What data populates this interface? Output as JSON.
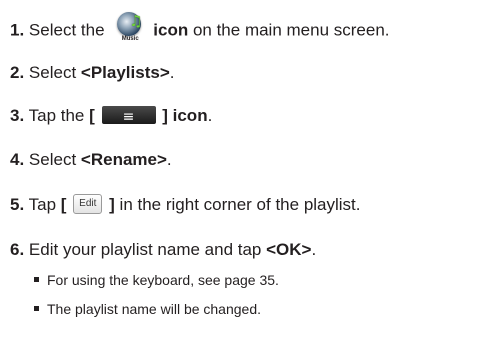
{
  "steps": [
    {
      "num": "1.",
      "pre": "Select the",
      "icon_caption": "Music",
      "icon_name": "music-app-icon",
      "bold": "icon",
      "post": "on the main menu screen."
    },
    {
      "num": "2.",
      "pre": "Select",
      "bold": "<Playlists>",
      "post": "."
    },
    {
      "num": "3.",
      "pre": "Tap the",
      "bracket_open": "[",
      "bold": "] icon",
      "post": ".",
      "key_glyph": "≡"
    },
    {
      "num": "4.",
      "pre": "Select",
      "bold": "<Rename>",
      "post": "."
    },
    {
      "num": "5.",
      "pre": "Tap",
      "bracket_open": "[",
      "button_label": "Edit",
      "bold": "]",
      "post": "in the right corner of the playlist."
    },
    {
      "num": "6.",
      "pre": "Edit your playlist name and tap",
      "bold": "<OK>",
      "post": "."
    }
  ],
  "notes": [
    "For using the keyboard, see page 35.",
    "The playlist name will be changed."
  ]
}
